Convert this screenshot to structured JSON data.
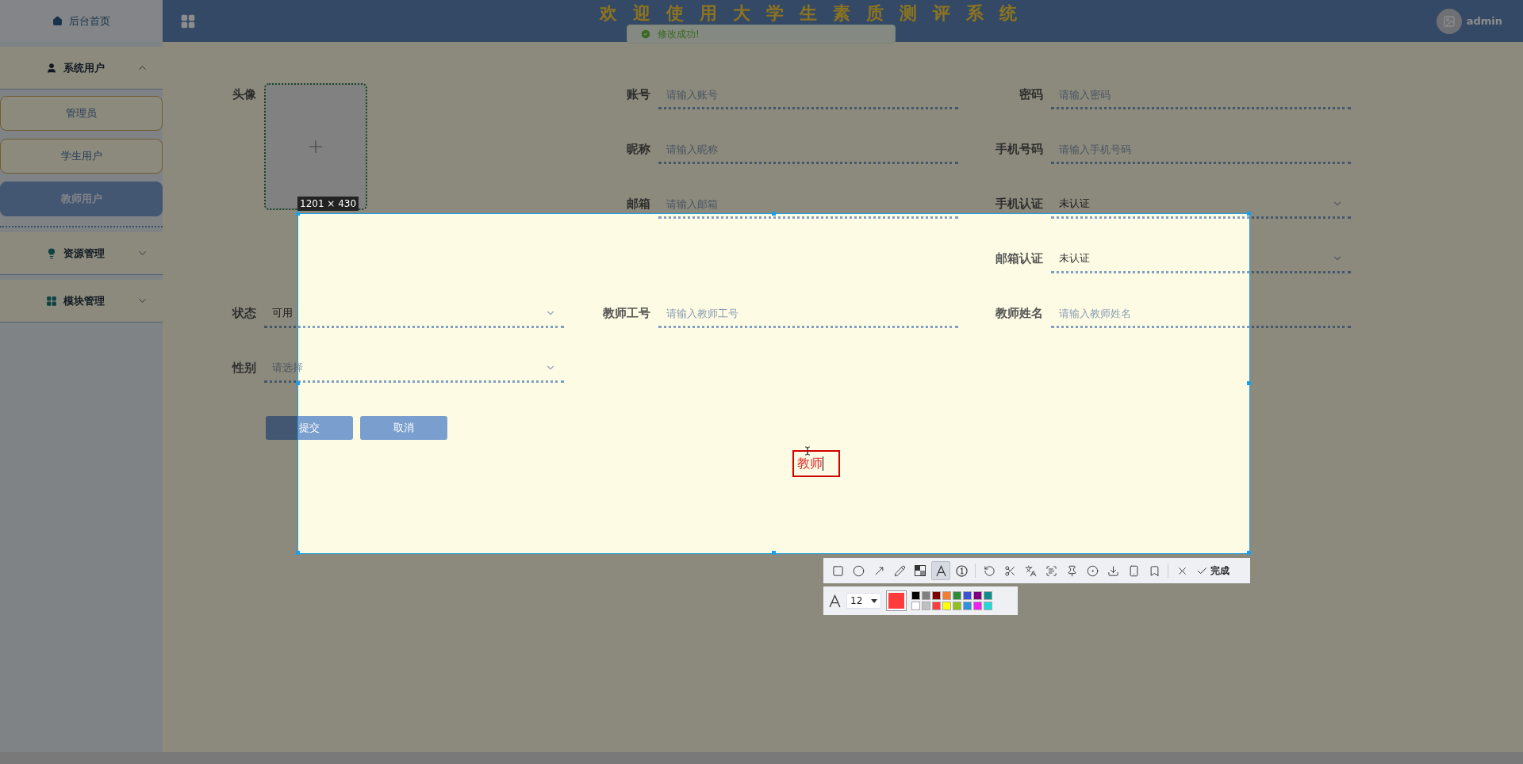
{
  "sidebar": {
    "home": {
      "label": "后台首页"
    },
    "groups": [
      {
        "label": "系统用户",
        "kind": "user",
        "expanded": true,
        "children": [
          {
            "label": "管理员",
            "selected": false
          },
          {
            "label": "学生用户",
            "selected": false
          },
          {
            "label": "教师用户",
            "selected": true
          }
        ]
      },
      {
        "label": "资源管理",
        "kind": "bulb",
        "expanded": false
      },
      {
        "label": "模块管理",
        "kind": "grid",
        "expanded": false
      }
    ]
  },
  "header": {
    "title": "欢迎使用大学生素质测评系统",
    "user": "admin"
  },
  "toast": {
    "message": "修改成功!"
  },
  "form": {
    "rows": [
      [
        {
          "kind": "avatar",
          "label": "头像"
        },
        {
          "kind": "input",
          "label": "账号",
          "placeholder": "请输入账号"
        },
        {
          "kind": "input",
          "label": "密码",
          "placeholder": "请输入密码"
        }
      ],
      [
        {
          "kind": "blank"
        },
        {
          "kind": "input",
          "label": "昵称",
          "placeholder": "请输入昵称"
        },
        {
          "kind": "input",
          "label": "手机号码",
          "placeholder": "请输入手机号码"
        }
      ],
      [
        {
          "kind": "blank"
        },
        {
          "kind": "input",
          "label": "邮箱",
          "placeholder": "请输入邮箱"
        },
        {
          "kind": "select",
          "label": "手机认证",
          "value": "未认证"
        }
      ],
      [
        {
          "kind": "blank"
        },
        {
          "kind": "blank"
        },
        {
          "kind": "select",
          "label": "邮箱认证",
          "value": "未认证"
        }
      ],
      [
        {
          "kind": "select",
          "label": "状态",
          "value": "可用"
        },
        {
          "kind": "input",
          "label": "教师工号",
          "placeholder": "请输入教师工号"
        },
        {
          "kind": "input",
          "label": "教师姓名",
          "placeholder": "请输入教师姓名"
        }
      ],
      [
        {
          "kind": "select",
          "label": "性别",
          "placeholder": "请选择"
        }
      ]
    ],
    "buttons": [
      "提交",
      "取消"
    ]
  },
  "capture": {
    "size_label": "1201 × 430",
    "annotation": "教师",
    "finish_label": "完成",
    "font_size": "12",
    "tools": [
      {
        "kind": "rectangle",
        "selected": false
      },
      {
        "kind": "ellipse",
        "selected": false
      },
      {
        "kind": "arrow",
        "selected": false
      },
      {
        "kind": "pencil",
        "selected": false
      },
      {
        "kind": "mosaic",
        "selected": false
      },
      {
        "kind": "text",
        "selected": true
      },
      {
        "kind": "number",
        "selected": false
      },
      {
        "kind": "separator"
      },
      {
        "kind": "undo",
        "selected": false
      },
      {
        "kind": "cut",
        "selected": false
      },
      {
        "kind": "translate",
        "selected": false
      },
      {
        "kind": "ocr",
        "selected": false
      },
      {
        "kind": "pin",
        "selected": false
      },
      {
        "kind": "record",
        "selected": false
      },
      {
        "kind": "download",
        "selected": false
      },
      {
        "kind": "phone",
        "selected": false
      },
      {
        "kind": "bookmark",
        "selected": false
      },
      {
        "kind": "separator"
      },
      {
        "kind": "close",
        "selected": false
      }
    ],
    "palette": [
      {
        "color": "#000000"
      },
      {
        "color": "#808080"
      },
      {
        "color": "#800000"
      },
      {
        "color": "#f08030"
      },
      {
        "color": "#2e8b3a"
      },
      {
        "color": "#3c50d8"
      },
      {
        "color": "#800080"
      },
      {
        "color": "#108c8c"
      },
      {
        "color": "#ffffff"
      },
      {
        "color": "#c0c0c0"
      },
      {
        "color": "#ff3b3b",
        "selected": true
      },
      {
        "color": "#ffff00"
      },
      {
        "color": "#90c020"
      },
      {
        "color": "#3090e0"
      },
      {
        "color": "#f020f0"
      },
      {
        "color": "#20d8d8"
      }
    ]
  }
}
